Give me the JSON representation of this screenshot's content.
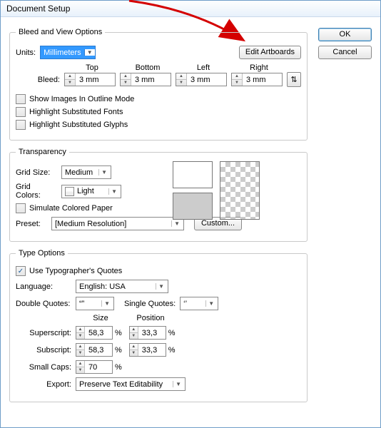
{
  "window": {
    "title": "Document Setup"
  },
  "buttons": {
    "ok": "OK",
    "cancel": "Cancel",
    "edit_artboards": "Edit Artboards",
    "custom": "Custom..."
  },
  "bleed_view": {
    "legend": "Bleed and View Options",
    "units_label": "Units:",
    "units_value": "Millimeters",
    "bleed_label": "Bleed:",
    "headers": {
      "top": "Top",
      "bottom": "Bottom",
      "left": "Left",
      "right": "Right"
    },
    "values": {
      "top": "3 mm",
      "bottom": "3 mm",
      "left": "3 mm",
      "right": "3 mm"
    },
    "chk_outline": "Show Images In Outline Mode",
    "chk_fonts": "Highlight Substituted Fonts",
    "chk_glyphs": "Highlight Substituted Glyphs"
  },
  "transparency": {
    "legend": "Transparency",
    "grid_size_label": "Grid Size:",
    "grid_size_value": "Medium",
    "grid_colors_label": "Grid Colors:",
    "grid_colors_value": "Light",
    "simulate_label": "Simulate Colored Paper",
    "preset_label": "Preset:",
    "preset_value": "[Medium Resolution]",
    "swatch_top": "#ffffff",
    "swatch_bottom": "#cccccc"
  },
  "type_options": {
    "legend": "Type Options",
    "use_typo_quotes": "Use Typographer's Quotes",
    "use_typo_quotes_checked": true,
    "language_label": "Language:",
    "language_value": "English: USA",
    "dq_label": "Double Quotes:",
    "dq_value": "“”",
    "sq_label": "Single Quotes:",
    "sq_value": "‘’",
    "size_hdr": "Size",
    "pos_hdr": "Position",
    "superscript_label": "Superscript:",
    "superscript_size": "58,3",
    "superscript_pos": "33,3",
    "subscript_label": "Subscript:",
    "subscript_size": "58,3",
    "subscript_pos": "33,3",
    "smallcaps_label": "Small Caps:",
    "smallcaps_value": "70",
    "export_label": "Export:",
    "export_value": "Preserve Text Editability",
    "pct": "%"
  },
  "arrow": {
    "color": "#d40000"
  }
}
